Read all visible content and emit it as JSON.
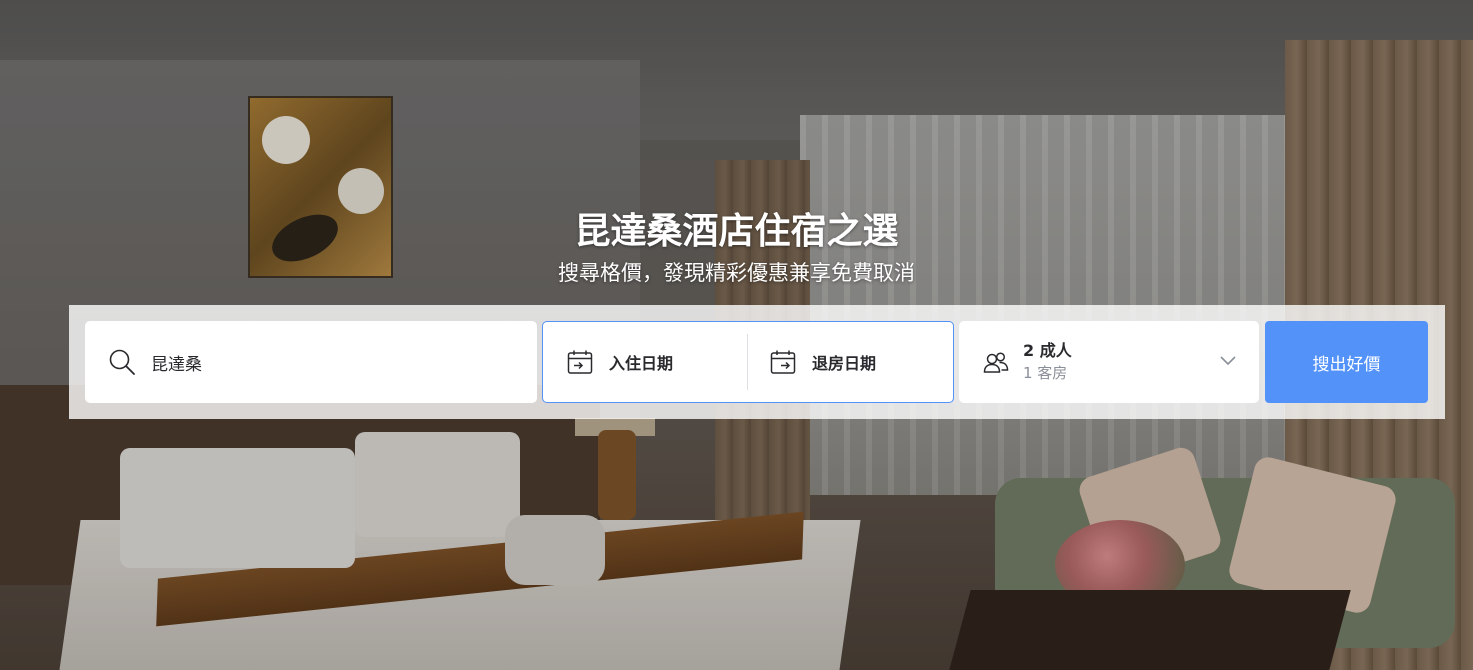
{
  "hero": {
    "title": "昆達桑酒店住宿之選",
    "subtitle": "搜尋格價，發現精彩優惠兼享免費取消"
  },
  "search": {
    "destination_value": "昆達桑",
    "checkin_label": "入住日期",
    "checkout_label": "退房日期",
    "guests_adults": "2 成人",
    "guests_rooms": "1 客房",
    "button_label": "搜出好價"
  },
  "colors": {
    "accent": "#5392f9",
    "text_primary": "#2a2a2e",
    "text_secondary": "#8a8f99"
  },
  "icons": {
    "destination": "search-icon",
    "checkin": "calendar-checkin-icon",
    "checkout": "calendar-checkout-icon",
    "guests": "users-icon",
    "dropdown": "chevron-down-icon"
  }
}
